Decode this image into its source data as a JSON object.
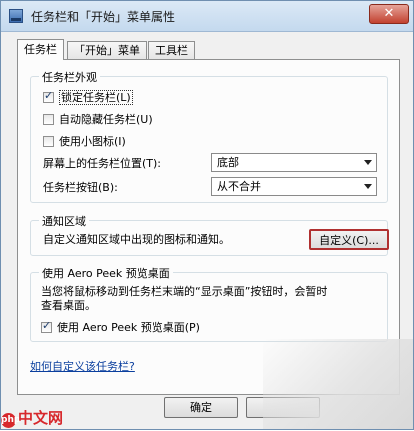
{
  "window": {
    "title": "任务栏和「开始」菜单属性",
    "close_label": "✕"
  },
  "tabs": [
    {
      "label": "任务栏",
      "active": true
    },
    {
      "label": "「开始」菜单",
      "active": false
    },
    {
      "label": "工具栏",
      "active": false
    }
  ],
  "appearance": {
    "legend": "任务栏外观",
    "lock_label": "锁定任务栏(L)",
    "lock_checked": true,
    "autohide_label": "自动隐藏任务栏(U)",
    "autohide_checked": false,
    "small_icons_label": "使用小图标(I)",
    "small_icons_checked": false,
    "position_label": "屏幕上的任务栏位置(T):",
    "position_value": "底部",
    "buttons_label": "任务栏按钮(B):",
    "buttons_value": "从不合并"
  },
  "notification": {
    "legend": "通知区域",
    "description": "自定义通知区域中出现的图标和通知。",
    "customize_button": "自定义(C)..."
  },
  "aero_peek": {
    "legend": "使用 Aero Peek 预览桌面",
    "description_line1": "当您将鼠标移动到任务栏末端的“显示桌面”按钮时，会暂时",
    "description_line2": "查看桌面。",
    "checkbox_label": "使用 Aero Peek 预览桌面(P)",
    "checkbox_checked": true
  },
  "help_link": "如何自定义该任务栏?",
  "footer": {
    "ok_button": "确定"
  },
  "watermark": {
    "badge": "php",
    "text": "中文网"
  }
}
